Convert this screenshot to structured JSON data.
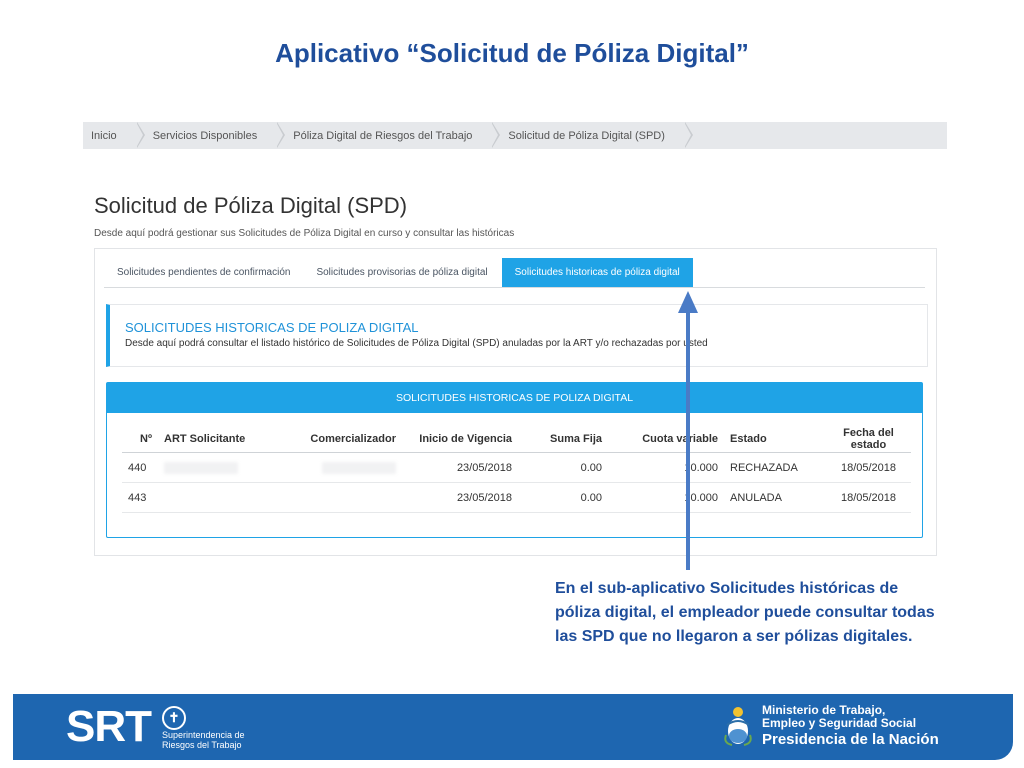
{
  "slide_title": "Aplicativo “Solicitud de Póliza Digital”",
  "breadcrumb": [
    "Inicio",
    "Servicios Disponibles",
    "Póliza Digital de Riesgos del Trabajo",
    "Solicitud de Póliza Digital (SPD)"
  ],
  "page": {
    "title": "Solicitud de Póliza Digital (SPD)",
    "subtitle": "Desde aquí podrá gestionar sus Solicitudes de Póliza Digital en curso y consultar las históricas"
  },
  "tabs": [
    {
      "label": "Solicitudes pendientes de confirmación",
      "active": false
    },
    {
      "label": "Solicitudes provisorias de póliza digital",
      "active": false
    },
    {
      "label": "Solicitudes historicas de póliza digital",
      "active": true
    }
  ],
  "info": {
    "title": "SOLICITUDES HISTORICAS DE POLIZA DIGITAL",
    "text": "Desde aquí podrá consultar el listado histórico de Solicitudes de Póliza Digital (SPD) anuladas por la ART y/o rechazadas por usted"
  },
  "table": {
    "header": "SOLICITUDES HISTORICAS DE POLIZA DIGITAL",
    "columns": [
      "Nº",
      "ART Solicitante",
      "Comercializador",
      "Inicio de Vigencia",
      "Suma Fija",
      "Cuota variable",
      "Estado",
      "Fecha del estado"
    ],
    "rows": [
      {
        "n": "440",
        "art": "",
        "comercializador": "",
        "inicio": "23/05/2018",
        "suma": "0.00",
        "cuota": "10.000",
        "estado": "RECHAZADA",
        "fecha": "18/05/2018"
      },
      {
        "n": "443",
        "art": "",
        "comercializador": "",
        "inicio": "23/05/2018",
        "suma": "0.00",
        "cuota": "10.000",
        "estado": "ANULADA",
        "fecha": "18/05/2018"
      }
    ]
  },
  "callout": "En el sub-aplicativo Solicitudes históricas de póliza digital, el empleador puede consultar todas las SPD que no llegaron a ser pólizas digitales.",
  "footer": {
    "srt": "SRT",
    "srt_line1": "Superintendencia de",
    "srt_line2": "Riesgos del Trabajo",
    "ministerio_line1": "Ministerio de Trabajo,",
    "ministerio_line2": "Empleo y Seguridad Social",
    "presidencia": "Presidencia de la Nación"
  },
  "colors": {
    "accent": "#1fa3e6",
    "title": "#1f4e9b",
    "footer": "#1e66b0",
    "arrow": "#4a7bc6"
  }
}
